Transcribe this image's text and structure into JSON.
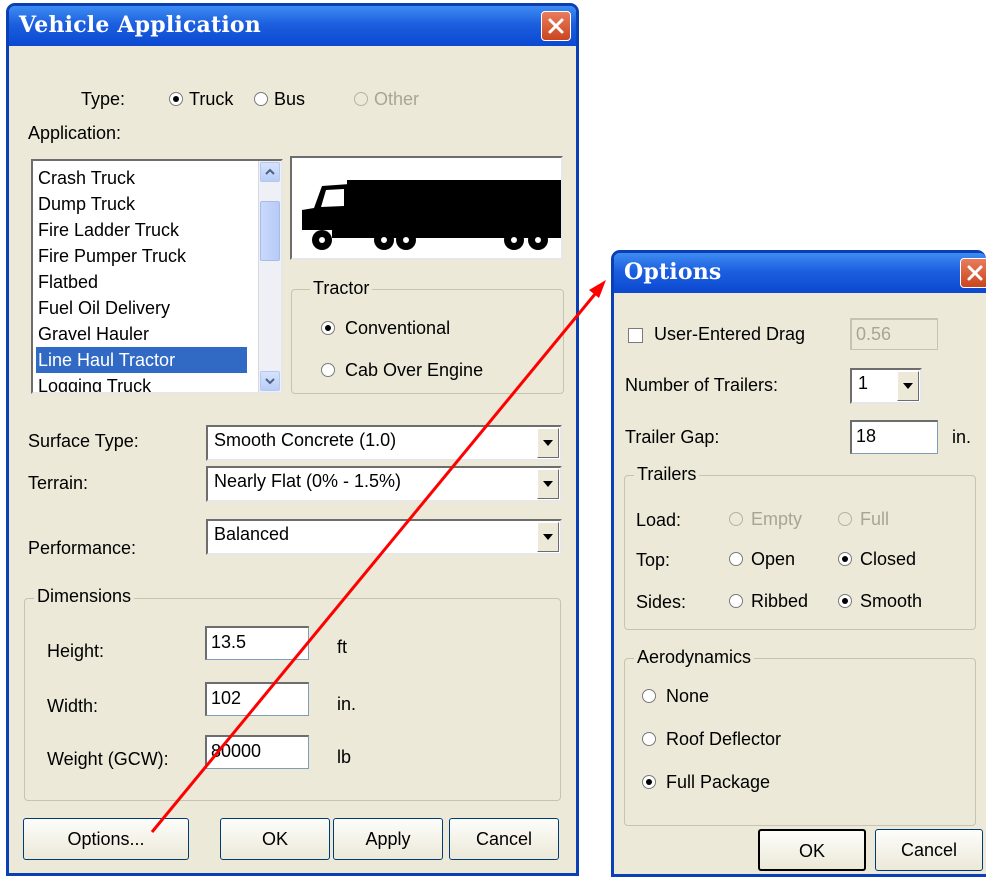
{
  "vehicle_dialog": {
    "title": "Vehicle Application",
    "type_label": "Type:",
    "type_options": [
      "Truck",
      "Bus",
      "Other"
    ],
    "type_selected": "Truck",
    "application_label": "Application:",
    "application_items": [
      "Crash Truck",
      "Dump Truck",
      "Fire Ladder Truck",
      "Fire Pumper Truck",
      "Flatbed",
      "Fuel Oil Delivery",
      "Gravel Hauler",
      "Line Haul Tractor",
      "Logging Truck"
    ],
    "application_selected": "Line Haul Tractor",
    "tractor_group": "Tractor",
    "tractor_options": [
      "Conventional",
      "Cab Over Engine"
    ],
    "tractor_selected": "Conventional",
    "surface_label": "Surface Type:",
    "surface_value": "Smooth Concrete (1.0)",
    "terrain_label": "Terrain:",
    "terrain_value": "Nearly Flat (0% - 1.5%)",
    "performance_label": "Performance:",
    "performance_value": "Balanced",
    "dimensions_group": "Dimensions",
    "height_label": "Height:",
    "height_value": "13.5",
    "height_unit": "ft",
    "width_label": "Width:",
    "width_value": "102",
    "width_unit": "in.",
    "weight_label": "Weight (GCW):",
    "weight_value": "80000",
    "weight_unit": "lb",
    "buttons": {
      "options": "Options...",
      "ok": "OK",
      "apply": "Apply",
      "cancel": "Cancel"
    }
  },
  "options_dialog": {
    "title": "Options",
    "user_drag_label": "User-Entered Drag",
    "user_drag_value": "0.56",
    "trailers_count_label": "Number of Trailers:",
    "trailers_count_value": "1",
    "trailer_gap_label": "Trailer Gap:",
    "trailer_gap_value": "18",
    "trailer_gap_unit": "in.",
    "trailers_group": "Trailers",
    "load_label": "Load:",
    "load_options": [
      "Empty",
      "Full"
    ],
    "top_label": "Top:",
    "top_options": [
      "Open",
      "Closed"
    ],
    "top_selected": "Closed",
    "sides_label": "Sides:",
    "sides_options": [
      "Ribbed",
      "Smooth"
    ],
    "sides_selected": "Smooth",
    "aero_group": "Aerodynamics",
    "aero_options": [
      "None",
      "Roof Deflector",
      "Full Package"
    ],
    "aero_selected": "Full Package",
    "buttons": {
      "ok": "OK",
      "cancel": "Cancel"
    }
  },
  "colors": {
    "title_bar": "#1d5fe0",
    "dialog_bg": "#ece9d8",
    "selection": "#316ac5",
    "annotation_arrow": "#ff0000"
  }
}
